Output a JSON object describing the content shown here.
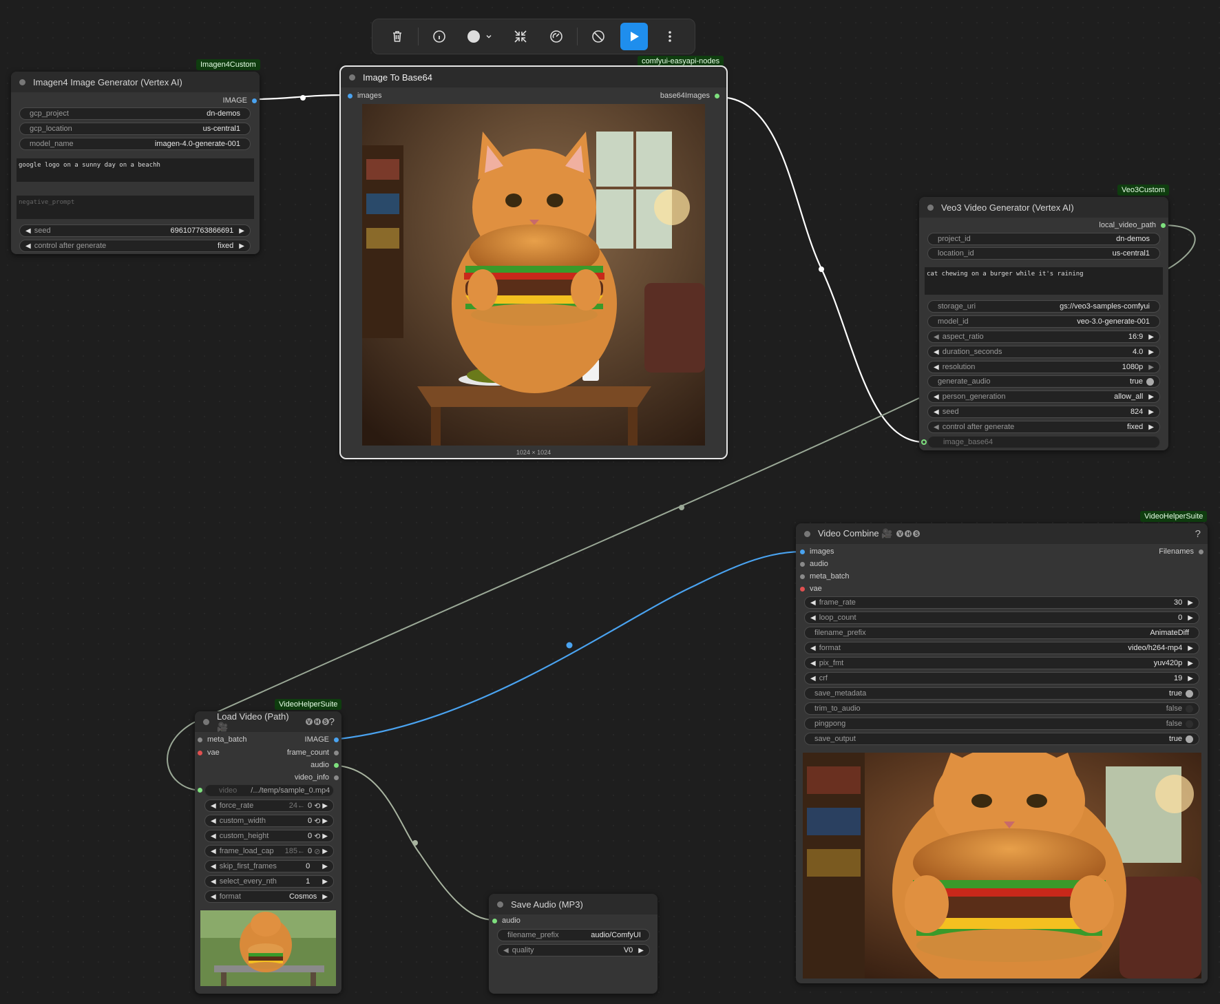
{
  "toolbar": {
    "buttons": [
      "trash-icon",
      "info-icon",
      "color-circle-icon",
      "collapse-icon",
      "pin-gauge-icon",
      "bypass-icon",
      "run-icon",
      "more-icon"
    ]
  },
  "nodes": {
    "imagen": {
      "badge": "Imagen4Custom",
      "title": "Imagen4 Image Generator (Vertex AI)",
      "output": "IMAGE",
      "widgets": {
        "gcp_project": {
          "label": "gcp_project",
          "value": "dn-demos"
        },
        "gcp_location": {
          "label": "gcp_location",
          "value": "us-central1"
        },
        "model_name": {
          "label": "model_name",
          "value": "imagen-4.0-generate-001"
        },
        "prompt": "google logo on a sunny day on a beachh",
        "negative_prompt": "negative_prompt",
        "seed": {
          "label": "seed",
          "value": "696107763866691"
        },
        "control": {
          "label": "control after generate",
          "value": "fixed"
        }
      }
    },
    "tobase64": {
      "badge": "comfyui-easyapi-nodes",
      "title": "Image To Base64",
      "input": "images",
      "output": "base64Images",
      "caption": "1024 × 1024"
    },
    "veo3": {
      "badge": "Veo3Custom",
      "title": "Veo3 Video Generator (Vertex AI)",
      "output": "local_video_path",
      "prompt": "cat chewing on a burger while it's raining",
      "project_id": {
        "label": "project_id",
        "value": "dn-demos"
      },
      "location_id": {
        "label": "location_id",
        "value": "us-central1"
      },
      "storage_uri": {
        "label": "storage_uri",
        "value": "gs://veo3-samples-comfyui"
      },
      "model_id": {
        "label": "model_id",
        "value": "veo-3.0-generate-001"
      },
      "aspect_ratio": {
        "label": "aspect_ratio",
        "value": "16:9"
      },
      "duration_seconds": {
        "label": "duration_seconds",
        "value": "4.0"
      },
      "resolution": {
        "label": "resolution",
        "value": "1080p"
      },
      "generate_audio": {
        "label": "generate_audio",
        "value": "true"
      },
      "person_generation": {
        "label": "person_generation",
        "value": "allow_all"
      },
      "seed": {
        "label": "seed",
        "value": "824"
      },
      "control": {
        "label": "control after generate",
        "value": "fixed"
      },
      "image_base64": {
        "label": "image_base64"
      }
    },
    "combine": {
      "badge": "VideoHelperSuite",
      "title": "Video Combine 🎥",
      "help": "?",
      "inputs": [
        "images",
        "audio",
        "meta_batch",
        "vae"
      ],
      "output": "Filenames",
      "frame_rate": {
        "label": "frame_rate",
        "value": "30"
      },
      "loop_count": {
        "label": "loop_count",
        "value": "0"
      },
      "filename_prefix": {
        "label": "filename_prefix",
        "value": "AnimateDiff"
      },
      "format": {
        "label": "format",
        "value": "video/h264-mp4"
      },
      "pix_fmt": {
        "label": "pix_fmt",
        "value": "yuv420p"
      },
      "crf": {
        "label": "crf",
        "value": "19"
      },
      "save_metadata": {
        "label": "save_metadata",
        "value": "true"
      },
      "trim_to_audio": {
        "label": "trim_to_audio",
        "value": "false"
      },
      "pingpong": {
        "label": "pingpong",
        "value": "false"
      },
      "save_output": {
        "label": "save_output",
        "value": "true"
      }
    },
    "loadvideo": {
      "badge": "VideoHelperSuite",
      "title": "Load Video (Path) 🎥",
      "help": "?",
      "in_meta": "meta_batch",
      "in_vae": "vae",
      "out_image": "IMAGE",
      "out_frame_count": "frame_count",
      "out_audio": "audio",
      "out_video_info": "video_info",
      "video": {
        "label": "video",
        "value": "/.../temp/sample_0.mp4"
      },
      "force_rate": {
        "label": "force_rate",
        "hint": "24←",
        "value": "0"
      },
      "custom_width": {
        "label": "custom_width",
        "value": "0"
      },
      "custom_height": {
        "label": "custom_height",
        "value": "0"
      },
      "frame_load_cap": {
        "label": "frame_load_cap",
        "hint": "185←",
        "value": "0"
      },
      "skip_first_frames": {
        "label": "skip_first_frames",
        "value": "0"
      },
      "select_every_nth": {
        "label": "select_every_nth",
        "value": "1"
      },
      "format": {
        "label": "format",
        "value": "Cosmos"
      }
    },
    "saveaudio": {
      "title": "Save Audio (MP3)",
      "input": "audio",
      "filename_prefix": {
        "label": "filename_prefix",
        "value": "audio/ComfyUI"
      },
      "quality": {
        "label": "quality",
        "value": "V0"
      }
    }
  },
  "colors": {
    "image_link": "#ffffff",
    "base64_link": "#ffffff",
    "video_link": "#9aa896",
    "images_link": "#4aa3f0",
    "audio_link": "#a8b4a0",
    "run_button": "#1f8eed",
    "badge_bg": "#0f3d0f"
  }
}
